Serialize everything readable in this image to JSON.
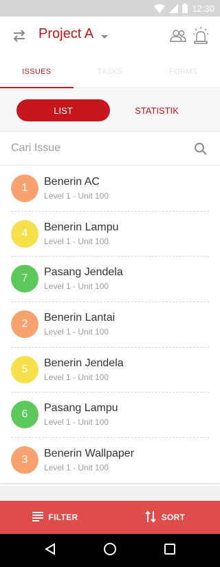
{
  "status_bar": {
    "time": "12:30"
  },
  "header": {
    "project_title": "Project A"
  },
  "tabs": [
    {
      "label": "ISSUES",
      "active": true
    },
    {
      "label": "TASKS",
      "active": false
    },
    {
      "label": "FORMS",
      "active": false
    }
  ],
  "segments": {
    "list_label": "LIST",
    "stat_label": "STATISTIK",
    "selected": "LIST"
  },
  "search": {
    "placeholder": "Cari Issue",
    "value": ""
  },
  "issues": [
    {
      "number": "1",
      "title": "Benerin AC",
      "location": "Level 1 - Unit 100",
      "color": "#f8a36f"
    },
    {
      "number": "4",
      "title": "Benerin Lampu",
      "location": "Level 1 - Unit 100",
      "color": "#f6e04b"
    },
    {
      "number": "7",
      "title": "Pasang Jendela",
      "location": "Level 1 - Unit 100",
      "color": "#5cc85c"
    },
    {
      "number": "2",
      "title": "Benerin Lantai",
      "location": "Level 1 - Unit 100",
      "color": "#f8a36f"
    },
    {
      "number": "5",
      "title": "Benerin Jendela",
      "location": "Level 1 - Unit 100",
      "color": "#f6e04b"
    },
    {
      "number": "6",
      "title": "Pasang Lampu",
      "location": "Level 1 - Unit 100",
      "color": "#5cc85c"
    },
    {
      "number": "3",
      "title": "Benerin Wallpaper",
      "location": "Level 1 - Unit 100",
      "color": "#f8a36f"
    }
  ],
  "bottom_bar": {
    "filter_label": "FILTER",
    "sort_label": "SORT"
  },
  "colors": {
    "primary": "#c4161c",
    "bottom_bar": "#e04b4b"
  }
}
